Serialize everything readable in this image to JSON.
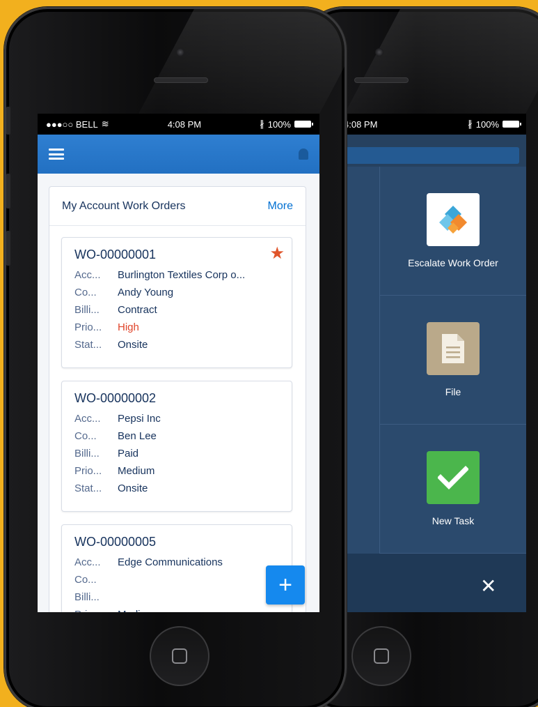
{
  "left_screen": {
    "status": {
      "carrier": "●●●○○ BELL",
      "time": "4:08 PM",
      "battery": "100%"
    },
    "card": {
      "title": "My Account Work Orders",
      "more_label": "More",
      "items": [
        {
          "id": "WO-00000001",
          "rows": [
            {
              "label": "Acc...",
              "value": "Burlington Textiles Corp o..."
            },
            {
              "label": "Co...",
              "value": "Andy Young"
            },
            {
              "label": "Billi...",
              "value": "Contract"
            },
            {
              "label": "Prio...",
              "value": "High"
            },
            {
              "label": "Stat...",
              "value": "Onsite"
            }
          ]
        },
        {
          "id": "WO-00000002",
          "rows": [
            {
              "label": "Acc...",
              "value": "Pepsi Inc"
            },
            {
              "label": "Co...",
              "value": "Ben Lee"
            },
            {
              "label": "Billi...",
              "value": "Paid"
            },
            {
              "label": "Prio...",
              "value": "Medium"
            },
            {
              "label": "Stat...",
              "value": "Onsite"
            }
          ]
        },
        {
          "id": "WO-00000005",
          "rows": [
            {
              "label": "Acc...",
              "value": "Edge Communications"
            },
            {
              "label": "Co...",
              "value": ""
            },
            {
              "label": "Billi...",
              "value": ""
            },
            {
              "label": "Prio...",
              "value": "Medium"
            }
          ]
        }
      ]
    },
    "fab_label": "+"
  },
  "right_screen": {
    "status": {
      "time": "4:08 PM",
      "battery": "100%"
    },
    "actions": [
      {
        "label": "Escalate Work Order",
        "icon": "escalate-icon"
      },
      {
        "label": "File",
        "icon": "file-icon"
      },
      {
        "label": "New Task",
        "icon": "checkmark-icon"
      }
    ],
    "close_label": "✕"
  },
  "colors": {
    "background": "#f2b01e",
    "navbar": "#2270c2",
    "accent": "#0070d2",
    "high_priority": "#e0442a",
    "star": "#e0552b",
    "fab": "#1589ee",
    "action_panel": "#2b4a6d",
    "task_tile": "#4bb64c",
    "file_tile": "#baa98a"
  }
}
